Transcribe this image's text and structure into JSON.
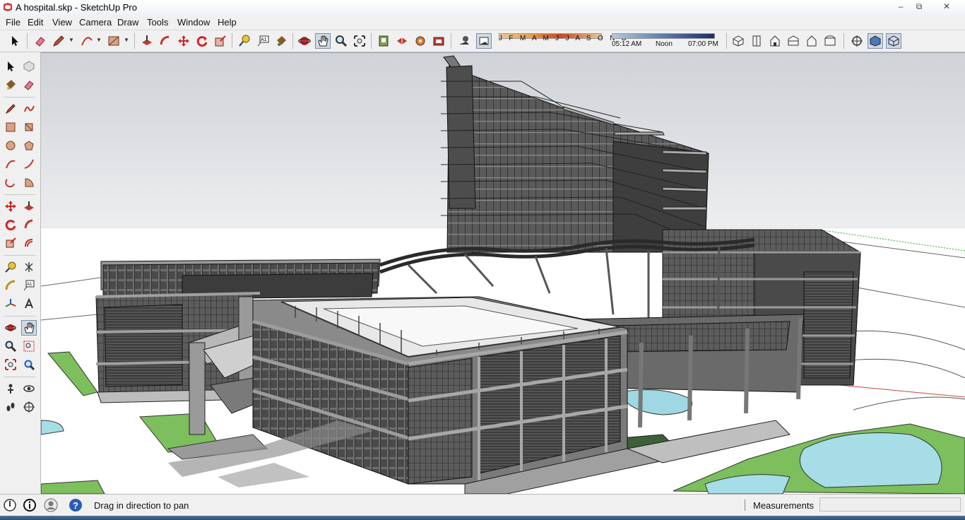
{
  "window": {
    "title": "A hospital.skp - SketchUp Pro",
    "minimize_glyph": "–",
    "maximize_glyph": "⧉",
    "close_glyph": "✕"
  },
  "menu": {
    "items": [
      "File",
      "Edit",
      "View",
      "Camera",
      "Draw",
      "Tools",
      "Window",
      "Help"
    ]
  },
  "toolbar": {
    "shadow_months": "J F M A M J J A S O N D",
    "shadow_time_start": "05:12 AM",
    "shadow_time_mid": "Noon",
    "shadow_time_end": "07:00 PM",
    "active_tool": "pan-icon"
  },
  "status": {
    "message": "Drag in direction to pan",
    "measurements_label": "Measurements",
    "measurements_value": ""
  },
  "colors": {
    "sky_top": "#d9dbde",
    "ground": "#ffffff",
    "building_gray": "#8c8c8c",
    "grass": "#7cbf5c",
    "water": "#9fd8e2",
    "active_tool_bg": "#cfd8e4"
  }
}
